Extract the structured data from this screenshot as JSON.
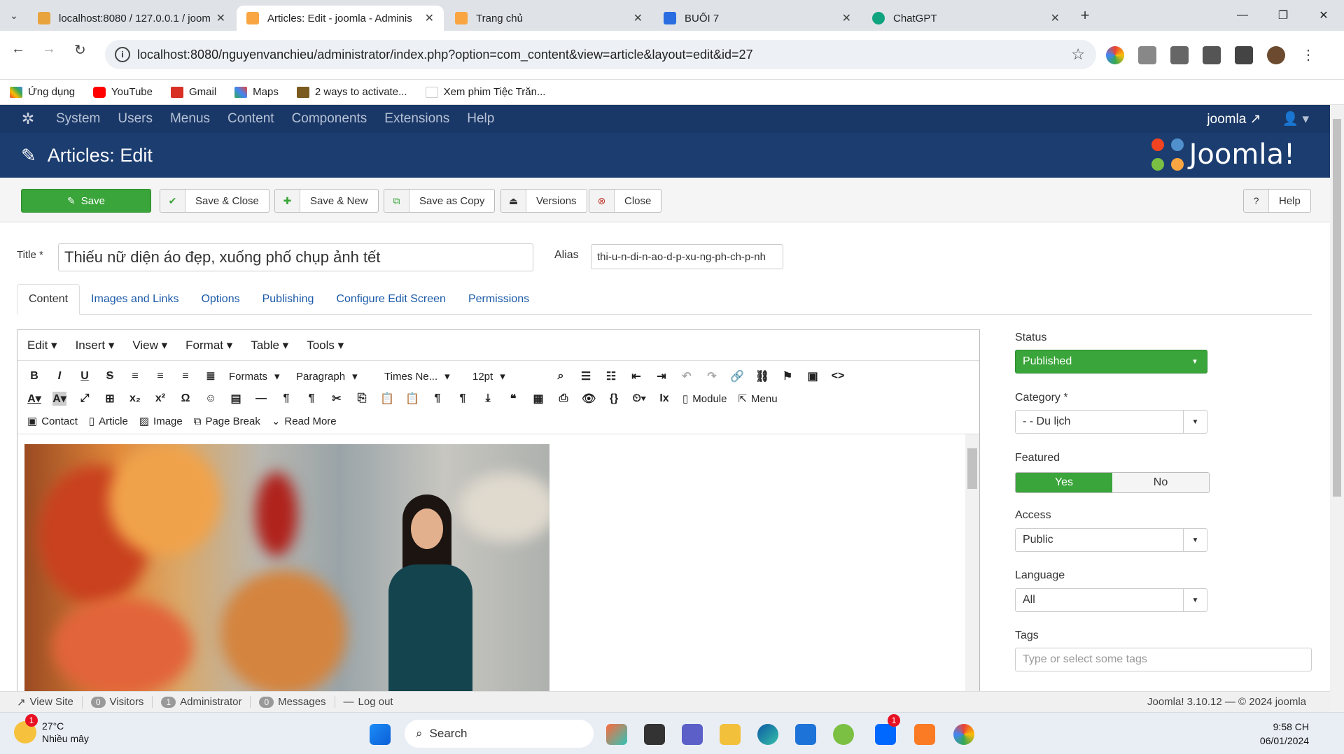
{
  "browser": {
    "tabs": [
      {
        "title": "localhost:8080 / 127.0.0.1 / joom",
        "active": false,
        "color": "#e8a33d"
      },
      {
        "title": "Articles: Edit - joomla - Adminis",
        "active": true,
        "color": "#f9a541"
      },
      {
        "title": "Trang chủ",
        "active": false,
        "color": "#f9a541"
      },
      {
        "title": "BUỔI 7",
        "active": false,
        "color": "#2a6de1"
      },
      {
        "title": "ChatGPT",
        "active": false,
        "color": "#10a37f"
      }
    ],
    "url": "localhost:8080/nguyenvanchieu/administrator/index.php?option=com_content&view=article&layout=edit&id=27",
    "bookmarks": [
      {
        "label": "Ứng dụng",
        "color": "#ea4335"
      },
      {
        "label": "YouTube",
        "color": "#ff0000"
      },
      {
        "label": "Gmail",
        "color": "#d93025"
      },
      {
        "label": "Maps",
        "color": "#34a853"
      },
      {
        "label": "2 ways to activate...",
        "color": "#7a5a1f"
      },
      {
        "label": "Xem phim Tiệc Trăn...",
        "color": "#ffffff"
      }
    ]
  },
  "joomla": {
    "menu": [
      "System",
      "Users",
      "Menus",
      "Content",
      "Components",
      "Extensions",
      "Help"
    ],
    "user": "joomla",
    "page_title": "Articles: Edit",
    "brand": "Joomla!",
    "toolbar": {
      "save": "Save",
      "save_close": "Save & Close",
      "save_new": "Save & New",
      "save_copy": "Save as Copy",
      "versions": "Versions",
      "close": "Close",
      "help": "Help"
    },
    "title_label": "Title *",
    "title_value": "Thiếu nữ diện áo đẹp, xuống phố chụp ảnh tết",
    "alias_label": "Alias",
    "alias_value": "thi-u-n-di-n-ao-d-p-xu-ng-ph-ch-p-nh",
    "tabs": [
      "Content",
      "Images and Links",
      "Options",
      "Publishing",
      "Configure Edit Screen",
      "Permissions"
    ],
    "editor": {
      "menus": [
        "Edit",
        "Insert",
        "View",
        "Format",
        "Table",
        "Tools"
      ],
      "formats": "Formats",
      "paragraph": "Paragraph",
      "font": "Times Ne...",
      "size": "12pt",
      "module": "Module",
      "menu": "Menu",
      "buttons": [
        "Contact",
        "Article",
        "Image",
        "Page Break",
        "Read More"
      ]
    },
    "side": {
      "status_label": "Status",
      "status_value": "Published",
      "category_label": "Category *",
      "category_value": "- - Du lịch",
      "featured_label": "Featured",
      "featured_yes": "Yes",
      "featured_no": "No",
      "access_label": "Access",
      "access_value": "Public",
      "language_label": "Language",
      "language_value": "All",
      "tags_label": "Tags",
      "tags_placeholder": "Type or select some tags"
    },
    "status_bar": {
      "view_site": "View Site",
      "visitors_count": "0",
      "visitors": "Visitors",
      "admin_count": "1",
      "admin": "Administrator",
      "messages_count": "0",
      "messages": "Messages",
      "logout": "Log out",
      "version": "Joomla! 3.10.12 — © 2024 joomla"
    }
  },
  "taskbar": {
    "temp": "27°C",
    "weather": "Nhiều mây",
    "search": "Search",
    "time": "9:58 CH",
    "date": "06/01/2024",
    "weather_badge": "1",
    "zalo_badge": "1"
  }
}
